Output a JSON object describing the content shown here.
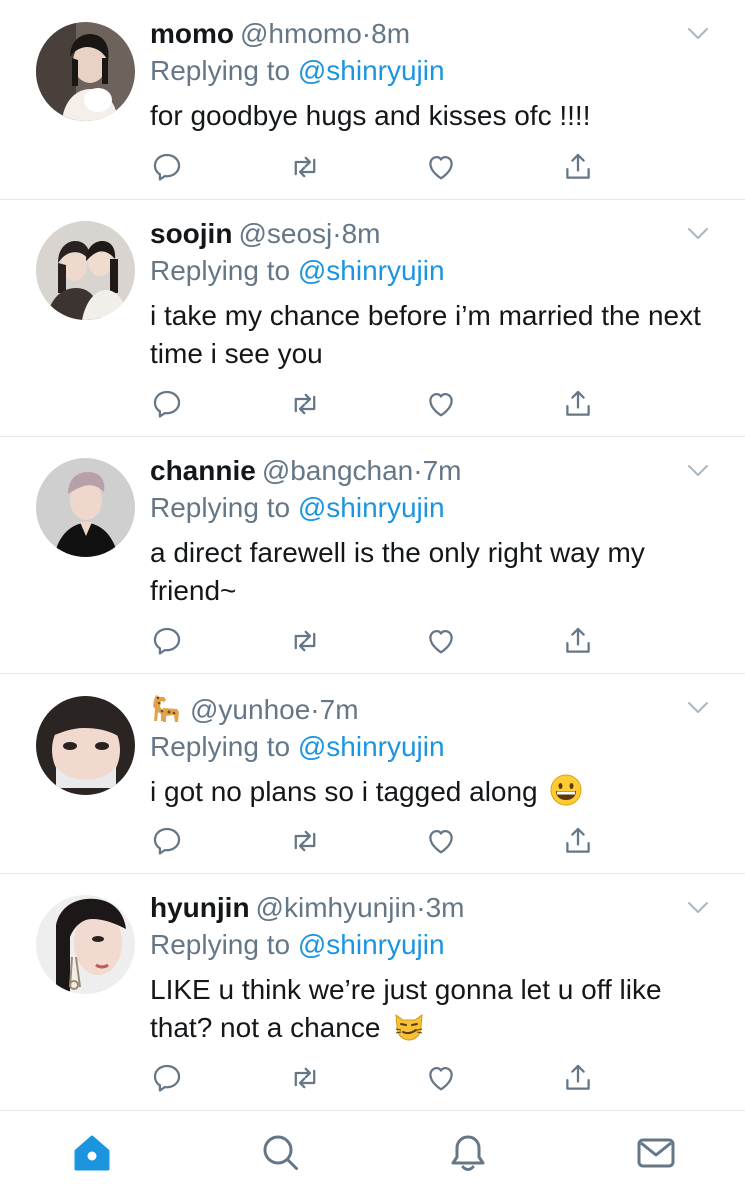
{
  "colors": {
    "accent": "#1b95e0",
    "muted": "#657786",
    "text": "#14171a",
    "divider": "#e1e8ed"
  },
  "tweets": [
    {
      "name": "momo",
      "handle": "@hmomo",
      "dot": "·",
      "time": "8m",
      "reply_prefix": "Replying to",
      "reply_to": "@shinryujin",
      "text": "for goodbye hugs and kisses ofc !!!!",
      "avatar": "avatar-momo"
    },
    {
      "name": "soojin",
      "handle": "@seosj",
      "dot": "·",
      "time": "8m",
      "reply_prefix": "Replying to",
      "reply_to": "@shinryujin",
      "text": "i take my chance before i’m married the next time i see you",
      "avatar": "avatar-soojin"
    },
    {
      "name": "channie",
      "handle": "@bangchan",
      "dot": "·",
      "time": "7m",
      "reply_prefix": "Replying to",
      "reply_to": "@shinryujin",
      "text": "a direct farewell is the only right way my friend~",
      "avatar": "avatar-channie"
    },
    {
      "name": "",
      "name_icon": "giraffe-icon",
      "handle": "@yunhoe",
      "dot": "·",
      "time": "7m",
      "reply_prefix": "Replying to",
      "reply_to": "@shinryujin",
      "text": "i got no plans so i tagged along",
      "text_emoji": "grinning-face-icon",
      "avatar": "avatar-yunhoe"
    },
    {
      "name": "hyunjin",
      "handle": "@kimhyunjin",
      "dot": "·",
      "time": "3m",
      "reply_prefix": "Replying to",
      "reply_to": "@shinryujin",
      "text": "LIKE u think we’re just gonna let u off like that? not a chance",
      "text_emoji": "smirking-cat-icon",
      "avatar": "avatar-hyunjin"
    }
  ],
  "actions": [
    "reply-icon",
    "retweet-icon",
    "like-icon",
    "share-icon"
  ],
  "tabbar": [
    "home-icon",
    "search-icon",
    "notifications-icon",
    "messages-icon"
  ]
}
